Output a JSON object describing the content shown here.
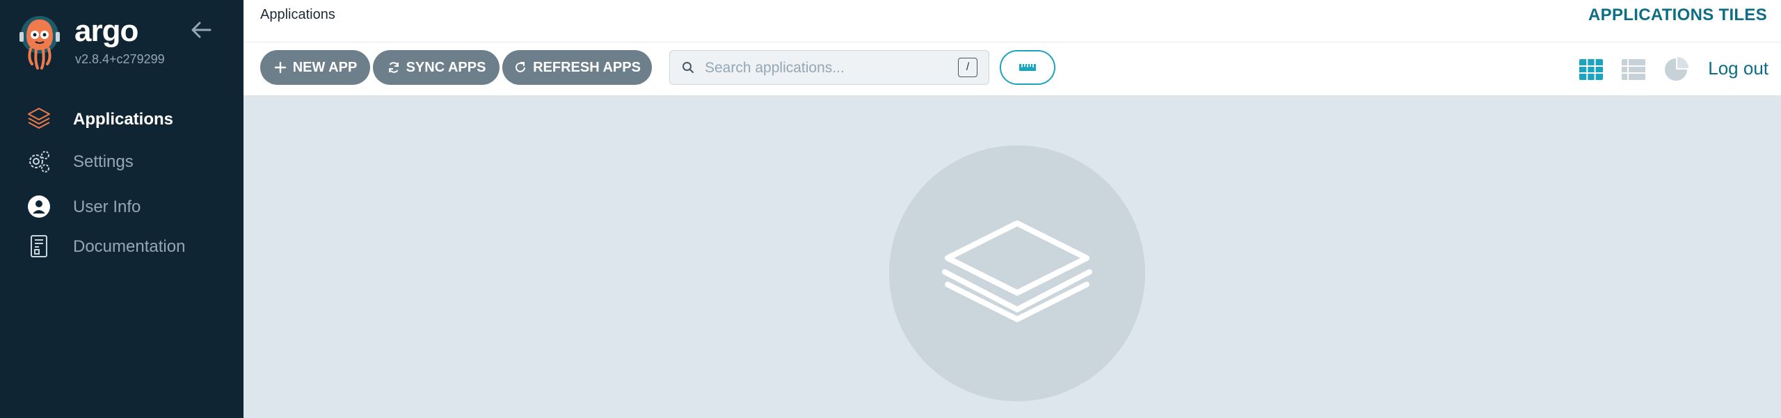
{
  "sidebar": {
    "brand_name": "argo",
    "version": "v2.8.4+c279299",
    "logo_icon": "argo-octopus-logo",
    "collapse_icon": "arrow-left-icon",
    "items": [
      {
        "label": "Applications",
        "icon": "layers-icon",
        "active": true
      },
      {
        "label": "Settings",
        "icon": "gear-icon",
        "active": false
      },
      {
        "label": "User Info",
        "icon": "user-circle-icon",
        "active": false
      },
      {
        "label": "Documentation",
        "icon": "book-icon",
        "active": false
      }
    ]
  },
  "header": {
    "breadcrumb": "Applications",
    "title": "APPLICATIONS TILES"
  },
  "toolbar": {
    "new_app_label": "NEW APP",
    "sync_apps_label": "SYNC APPS",
    "refresh_apps_label": "REFRESH APPS",
    "search_placeholder": "Search applications...",
    "search_shortcut": "/",
    "logout_label": "Log out",
    "views": [
      "tiles-view-icon",
      "list-view-icon",
      "summary-pie-icon"
    ],
    "active_view": "tiles-view-icon"
  },
  "colors": {
    "sidebar_bg": "#0f2533",
    "accent": "#0d6d85",
    "button_bg": "#6d7f8b",
    "tiles_active": "#1ca3bd",
    "content_bg": "#dee6ed"
  }
}
